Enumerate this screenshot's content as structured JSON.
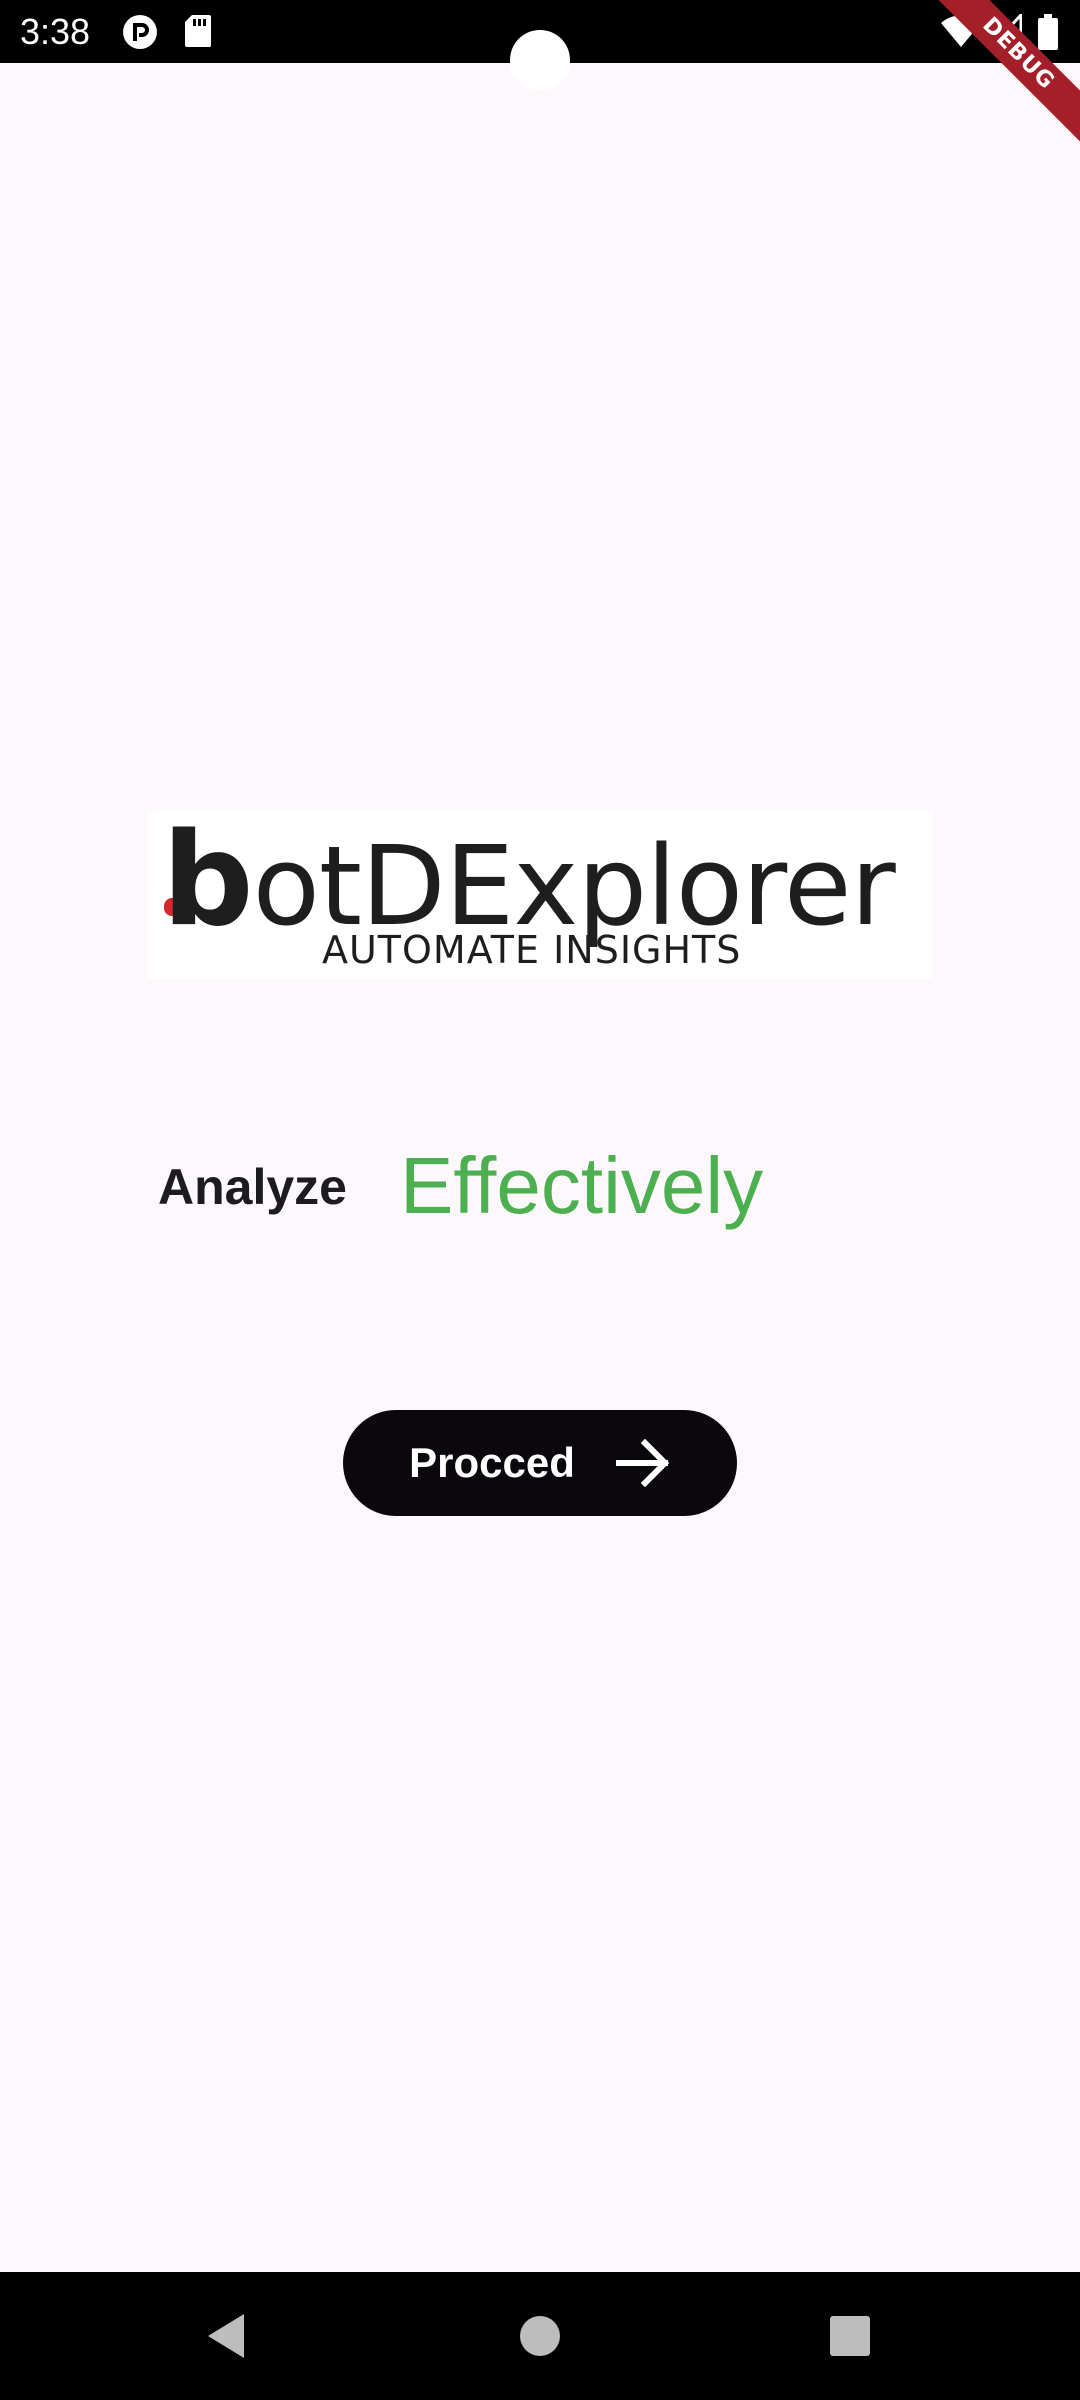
{
  "status_bar": {
    "time": "3:38",
    "left_icons": [
      "pocket-casts-icon",
      "sd-card-icon"
    ],
    "right_icons": [
      "wifi-icon",
      "signal-icon",
      "battery-icon"
    ]
  },
  "debug_banner": {
    "label": "DEBUG",
    "color": "#a51f2a"
  },
  "logo": {
    "title_b": "b",
    "title_rest": "otDExplorer",
    "tagline": "AUTOMATE INSIGHTS",
    "accent_color": "#d7262e"
  },
  "hero": {
    "analyze": "Analyze",
    "effectively": "Effectively",
    "effectively_color": "#4caf50"
  },
  "proceed_button": {
    "label": "Procced",
    "icon": "arrow-right-icon",
    "background": "#0a080c"
  },
  "nav_bar": {
    "buttons": [
      "back-icon",
      "home-icon",
      "recents-icon"
    ]
  }
}
